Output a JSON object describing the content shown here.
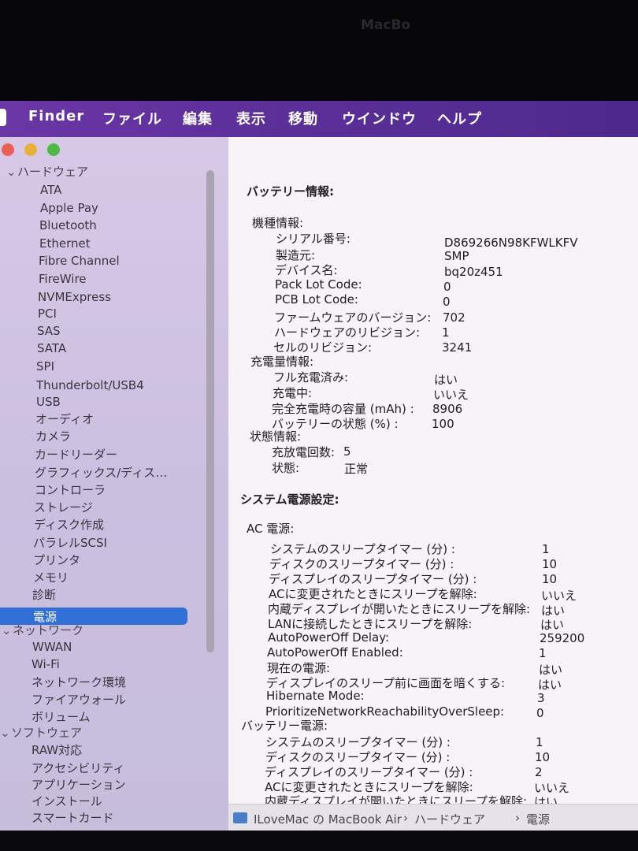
{
  "menubar": {
    "app": "Finder",
    "items": [
      "ファイル",
      "編集",
      "表示",
      "移動",
      "ウインドウ",
      "ヘルプ"
    ]
  },
  "window_title": "MacBo",
  "sidebar": {
    "hardware_header": "ハードウェア",
    "hardware_items": [
      "ATA",
      "Apple Pay",
      "Bluetooth",
      "Ethernet",
      "Fibre Channel",
      "FireWire",
      "NVMExpress",
      "PCI",
      "SAS",
      "SATA",
      "SPI",
      "Thunderbolt/USB4",
      "USB",
      "オーディオ",
      "カメラ",
      "カードリーダー",
      "グラフィックス/ディス…",
      "コントローラ",
      "ストレージ",
      "ディスク作成",
      "パラレルSCSI",
      "プリンタ",
      "メモリ",
      "診断",
      "電源"
    ],
    "selected": "電源",
    "network_header": "ネットワーク",
    "network_items": [
      "WWAN",
      "Wi-Fi",
      "ネットワーク環境",
      "ファイアウォール",
      "ボリューム"
    ],
    "software_header": "ソフトウェア",
    "software_items": [
      "RAW対応",
      "アクセシビリティ",
      "アプリケーション",
      "インストール",
      "スマートカード"
    ]
  },
  "content": {
    "battery_info_title": "バッテリー情報:",
    "model_info": {
      "header": "機種情報:",
      "rows": [
        {
          "label": "シリアル番号:",
          "value": "D869266N98KFWLKFV"
        },
        {
          "label": "製造元:",
          "value": "SMP"
        },
        {
          "label": "デバイス名:",
          "value": "bq20z451"
        },
        {
          "label": "Pack Lot Code:",
          "value": "0"
        },
        {
          "label": "PCB Lot Code:",
          "value": "0"
        },
        {
          "label": "ファームウェアのバージョン:",
          "value": "702"
        },
        {
          "label": "ハードウェアのリビジョン:",
          "value": "1"
        },
        {
          "label": "セルのリビジョン:",
          "value": "3241"
        }
      ]
    },
    "charge_info": {
      "header": "充電量情報:",
      "rows": [
        {
          "label": "フル充電済み:",
          "value": "はい"
        },
        {
          "label": "充電中:",
          "value": "いいえ"
        },
        {
          "label": "完全充電時の容量 (mAh) :",
          "value": "8906"
        },
        {
          "label": "バッテリーの状態 (%) :",
          "value": "100"
        }
      ]
    },
    "status_info": {
      "header": "状態情報:",
      "rows": [
        {
          "label": "充放電回数:",
          "value": "5"
        },
        {
          "label": "状態:",
          "value": "正常"
        }
      ]
    },
    "system_power_title": "システム電源設定:",
    "ac_power": {
      "header": "AC 電源:",
      "rows": [
        {
          "label": "システムのスリープタイマー (分) :",
          "value": "1"
        },
        {
          "label": "ディスクのスリープタイマー (分) :",
          "value": "10"
        },
        {
          "label": "ディスプレイのスリープタイマー (分) :",
          "value": "10"
        },
        {
          "label": "ACに変更されたときにスリープを解除:",
          "value": "いいえ"
        },
        {
          "label": "内蔵ディスプレイが開いたときにスリープを解除:",
          "value": "はい"
        },
        {
          "label": "LANに接続したときにスリープを解除:",
          "value": "はい"
        },
        {
          "label": "AutoPowerOff Delay:",
          "value": "259200"
        },
        {
          "label": "AutoPowerOff Enabled:",
          "value": "1"
        },
        {
          "label": "現在の電源:",
          "value": "はい"
        },
        {
          "label": "ディスプレイのスリープ前に画面を暗くする:",
          "value": "はい"
        },
        {
          "label": "Hibernate Mode:",
          "value": "3"
        },
        {
          "label": "PrioritizeNetworkReachabilityOverSleep:",
          "value": "0"
        }
      ]
    },
    "battery_power": {
      "header": "バッテリー電源:",
      "rows": [
        {
          "label": "システムのスリープタイマー (分) :",
          "value": "1"
        },
        {
          "label": "ディスクのスリープタイマー (分) :",
          "value": "10"
        },
        {
          "label": "ディスプレイのスリープタイマー (分) :",
          "value": "2"
        },
        {
          "label": "ACに変更されたときにスリープを解除:",
          "value": "いいえ"
        },
        {
          "label": "内蔵ディスプレイが開いたときにスリープを解除:",
          "value": "はい"
        }
      ]
    }
  },
  "pathbar": {
    "device": "ILoveMac の MacBook Air",
    "section": "ハードウェア",
    "item": "電源",
    "separator": "›"
  },
  "colors": {
    "menubar": "#5b2f98",
    "selection": "#2f6fd6",
    "close": "#ec5f57",
    "minimize": "#e6b13b",
    "zoom": "#4eb944"
  }
}
